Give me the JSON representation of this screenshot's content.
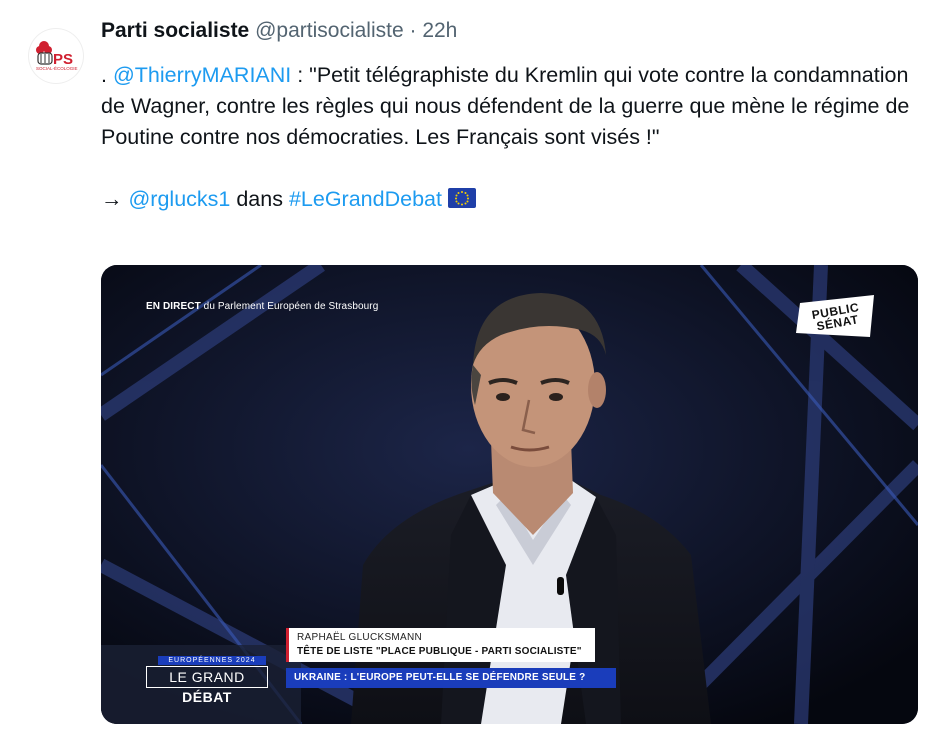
{
  "tweet": {
    "author_name": "Parti socialiste",
    "author_handle": "@partisocialiste",
    "separator": "·",
    "time": "22h",
    "avatar_logo_text": "PS",
    "avatar_logo_subtext": "SOCIAL-ÉCOLOGIE",
    "line1_prefix": ". ",
    "mention1": "@ThierryMARIANI",
    "quote_text": " : \"Petit télégraphiste du Kremlin qui vote contre la condamnation de Wagner, contre  les règles qui nous défendent de la guerre  que mène le régime de Poutine contre nos démocraties. Les Français sont visés !\"",
    "arrow": "→ ",
    "mention2": "@rglucks1",
    "connector": " dans ",
    "hashtag": "#LeGrandDebat",
    "flag_icon": "eu-flag-icon"
  },
  "media": {
    "live_bold": "EN DIRECT",
    "live_rest": " du Parlement Européen de Strasbourg",
    "channel_line1": "PUBLIC",
    "channel_line2": "SÉNAT",
    "speaker_name": "RAPHAËL GLUCKSMANN",
    "speaker_title": "TÊTE DE LISTE \"PLACE PUBLIQUE - PARTI SOCIALISTE\"",
    "topic": "UKRAINE : L'EUROPE PEUT-ELLE SE DÉFENDRE SEULE ?",
    "show_top": "EUROPÉENNES 2024",
    "show_main": "LE GRAND ",
    "show_main_bold": "DÉBAT"
  },
  "colors": {
    "link": "#1d9bf0",
    "ps_red": "#d02030",
    "banner_blue": "#1a3dbb"
  }
}
